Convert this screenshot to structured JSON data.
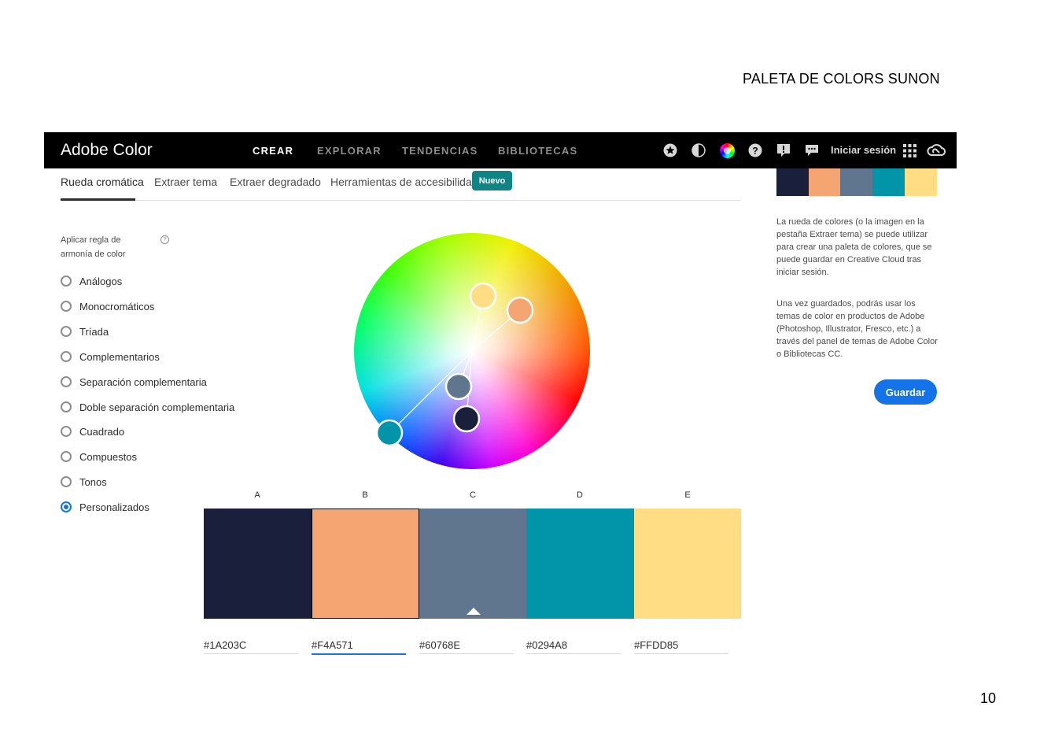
{
  "page_title": "PALETA DE COLORS SUNON",
  "page_number": "10",
  "topbar": {
    "brand": "Adobe Color",
    "nav": [
      "CREAR",
      "EXPLORAR",
      "TENDENCIAS",
      "BIBLIOTECAS"
    ],
    "active_nav": "CREAR",
    "icons": [
      "star-badge-icon",
      "contrast-icon",
      "color-wheel-icon",
      "help-icon",
      "alert-icon",
      "chat-icon"
    ],
    "signin": "Iniciar sesión",
    "right_icons": [
      "apps-grid-icon",
      "creative-cloud-icon"
    ]
  },
  "tabs": {
    "items": [
      "Rueda cromática",
      "Extraer tema",
      "Extraer degradado",
      "Herramientas de accesibilidad"
    ],
    "active": "Rueda cromática",
    "badge": "Nuevo"
  },
  "harmony": {
    "label": "Aplicar regla de armonía de color",
    "options": [
      "Análogos",
      "Monocromáticos",
      "Tríada",
      "Complementarios",
      "Separación complementaria",
      "Doble separación complementaria",
      "Cuadrado",
      "Compuestos",
      "Tonos",
      "Personalizados"
    ],
    "selected": "Personalizados"
  },
  "swatches": [
    {
      "letter": "A",
      "hex": "#1A203C",
      "color": "#1a203c"
    },
    {
      "letter": "B",
      "hex": "#F4A571",
      "color": "#f4a571"
    },
    {
      "letter": "C",
      "hex": "#60768E",
      "color": "#60768e"
    },
    {
      "letter": "D",
      "hex": "#0294A8",
      "color": "#0294a8"
    },
    {
      "letter": "E",
      "hex": "#FFDD85",
      "color": "#ffdd85"
    }
  ],
  "selected_swatch": "B",
  "focused_hex": "#F4A571",
  "side_panel": {
    "paragraph1": "La rueda de colores (o la imagen en la pestaña Extraer tema) se puede utilizar para crear una paleta de colores, que se puede guardar en Creative Cloud tras iniciar sesión.",
    "paragraph2": "Una vez guardados, podrás usar los temas de color en productos de Adobe (Photoshop, Illustrator, Fresco, etc.) a través del panel de temas de Adobe Color o Bibliotecas CC.",
    "save_label": "Guardar"
  }
}
